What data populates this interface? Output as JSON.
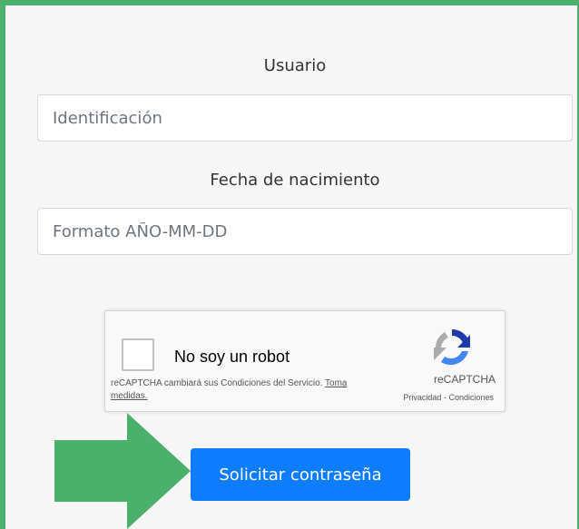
{
  "form": {
    "user_label": "Usuario",
    "user_placeholder": "Identificación",
    "user_value": "",
    "birth_label": "Fecha de nacimiento",
    "birth_placeholder": "Formato AÑO-MM-DD",
    "birth_value": ""
  },
  "captcha": {
    "checkbox_label": "No soy un robot",
    "notice_text": "reCAPTCHA cambiará sus Condiciones del Servicio. ",
    "notice_link": "Toma medidas.",
    "brand": "reCAPTCHA",
    "privacy": "Privacidad",
    "separator": "-",
    "terms": "Condiciones",
    "logo_icon": "recaptcha-logo-icon"
  },
  "submit": {
    "label": "Solicitar contraseña"
  },
  "colors": {
    "frame_border": "#4bb06b",
    "submit_background": "#0d7dfd",
    "arrow": "#4bb06b"
  }
}
